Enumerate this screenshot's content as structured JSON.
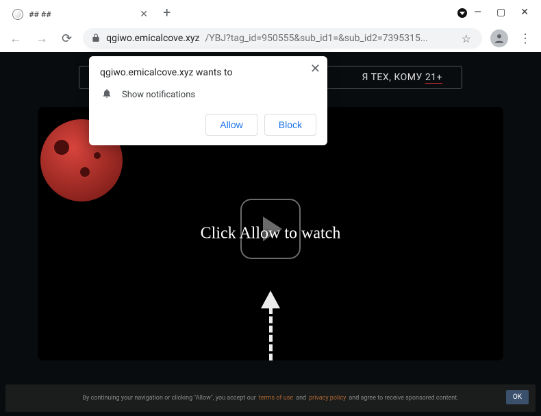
{
  "window": {
    "tab_title": "## ##",
    "incognito_marker": true
  },
  "toolbar": {
    "url_host": "qgiwo.emicalcove.xyz",
    "url_path": "/YBJ?tag_id=950555&sub_id1=&sub_id2=7395315...",
    "secure": true
  },
  "permission_prompt": {
    "origin_text": "qgiwo.emicalcove.xyz wants to",
    "permission_label": "Show notifications",
    "allow_label": "Allow",
    "block_label": "Block"
  },
  "page": {
    "banner_text_suffix": "Я ТЕХ, КОМУ ",
    "banner_age": "21+",
    "cta_text": "Click Allow to watch",
    "cookie_text_prefix": "By continuing your navigation or clicking \"Allow\", you accept our",
    "cookie_link1": "terms of use",
    "cookie_and": "and",
    "cookie_link2": "privacy policy",
    "cookie_text_suffix": "and agree to receive sponsored content.",
    "cookie_ok": "OK"
  }
}
